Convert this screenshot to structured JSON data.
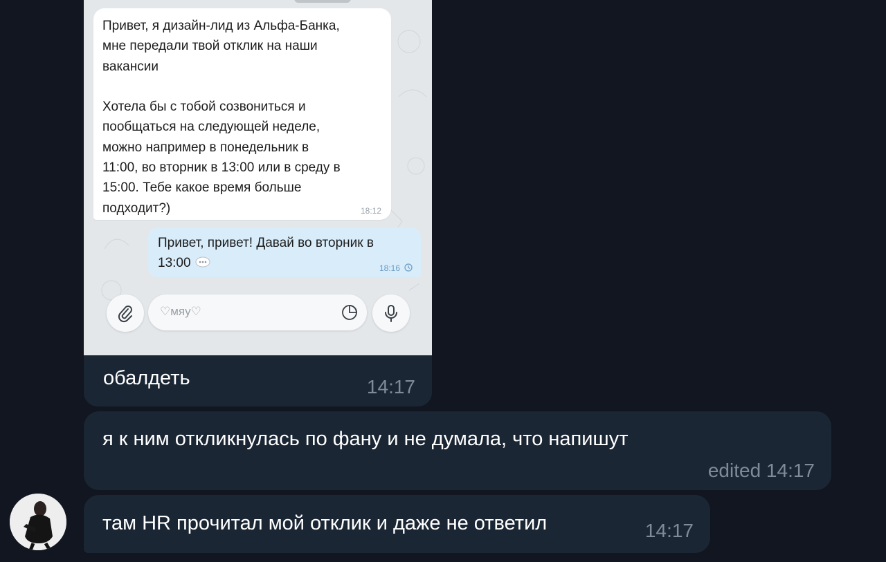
{
  "screenshot": {
    "incoming_message": {
      "text": "Привет, я дизайн-лид из Альфа-Банка,\nмне передали твой отклик на наши\nвакансии\n\nХотела бы с тобой созвониться и\nпообщаться на следующей неделе,\nможно например в понедельник в\n11:00, во вторник в 13:00 или в среду в\n15:00. Тебе какое время больше\nподходит?)",
      "time": "18:12"
    },
    "outgoing_message": {
      "text_line1": "Привет, привет! Давай во вторник в",
      "text_line2": "13:00",
      "time": "18:16"
    },
    "composer": {
      "placeholder": "♡мяу♡",
      "attach_icon": "paperclip-icon",
      "sticker_icon": "sticker-icon",
      "mic_icon": "microphone-icon"
    }
  },
  "messages": [
    {
      "text": "обалдеть",
      "time": "14:17"
    },
    {
      "text": "я к ним откликнулась по фану и не думала, что напишут",
      "time": "edited 14:17"
    },
    {
      "text": "там HR прочитал мой отклик и даже не ответил",
      "time": "14:17"
    }
  ],
  "colors": {
    "background": "#111620",
    "bubble_dark": "#1b2634",
    "time_dark": "#7f8b99",
    "bubble_light": "#ffffff",
    "bubble_outgoing": "#d8ecfa"
  }
}
